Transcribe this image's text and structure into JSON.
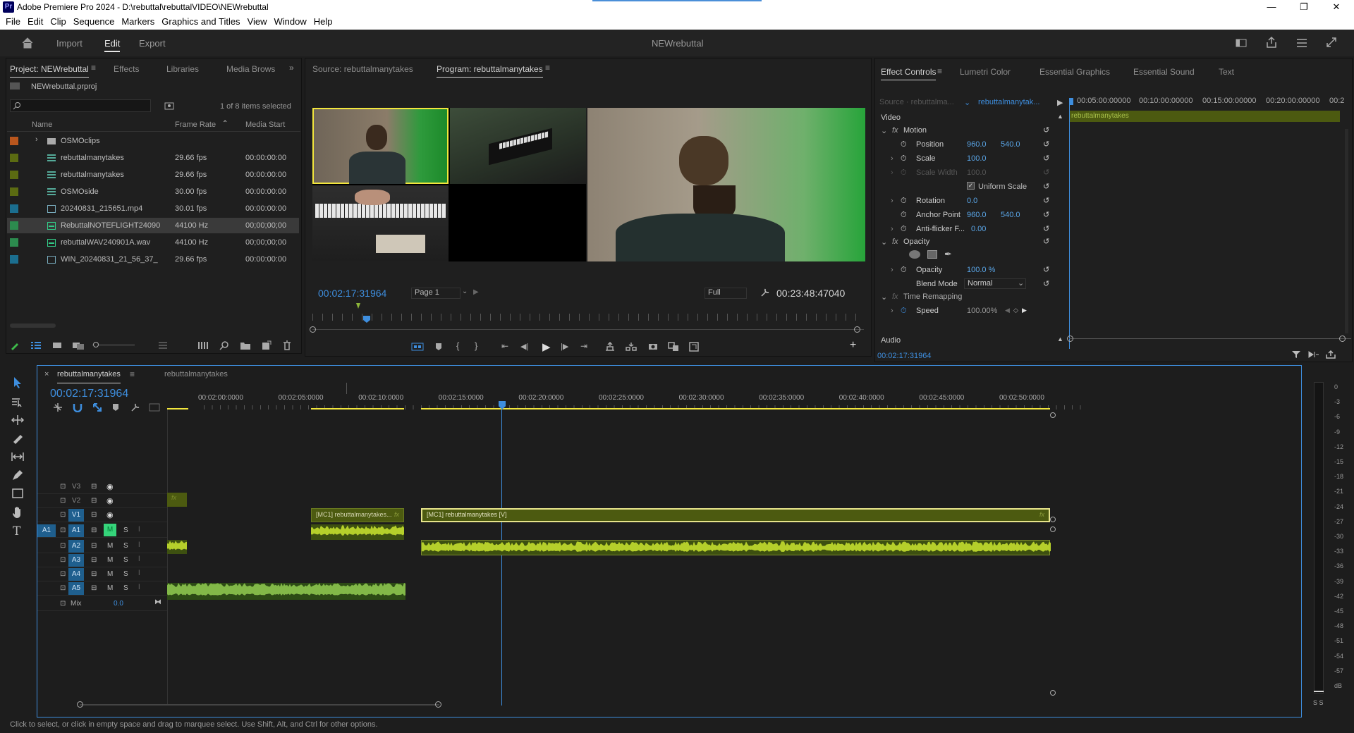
{
  "window": {
    "title": "Adobe Premiere Pro 2024 - D:\\rebuttal\\rebuttalVIDEO\\NEWrebuttal",
    "app_badge": "Pr",
    "minimize": "—",
    "maximize": "❐",
    "close": "✕"
  },
  "menu": [
    "File",
    "Edit",
    "Clip",
    "Sequence",
    "Markers",
    "Graphics and Titles",
    "View",
    "Window",
    "Help"
  ],
  "workspace": {
    "tabs": [
      "Import",
      "Edit",
      "Export"
    ],
    "active": "Edit",
    "project_name": "NEWrebuttal"
  },
  "project_panel": {
    "tabs": [
      "Project: NEWrebuttal",
      "Effects",
      "Libraries",
      "Media Brows"
    ],
    "file": "NEWrebuttal.prproj",
    "selection_count": "1 of 8 items selected",
    "columns": [
      "Name",
      "Frame Rate",
      "Media Start"
    ],
    "items": [
      {
        "name": "OSMOclips",
        "rate": "",
        "start": "",
        "color": "#b9561d",
        "type": "folder"
      },
      {
        "name": "rebuttalmanytakes",
        "rate": "29.66 fps",
        "start": "00:00:00:00",
        "color": "#5b6b12",
        "type": "sequence"
      },
      {
        "name": "rebuttalmanytakes",
        "rate": "29.66 fps",
        "start": "00:00:00:00",
        "color": "#5b6b12",
        "type": "multicam"
      },
      {
        "name": "OSMOside",
        "rate": "30.00 fps",
        "start": "00:00:00:00",
        "color": "#5b6b12",
        "type": "multicam"
      },
      {
        "name": "20240831_215651.mp4",
        "rate": "30.01 fps",
        "start": "00:00:00:00",
        "color": "#1b6e8f",
        "type": "video"
      },
      {
        "name": "RebuttalNOTEFLIGHT24090",
        "rate": "44100 Hz",
        "start": "00;00;00;00",
        "color": "#2c8b4e",
        "type": "audio"
      },
      {
        "name": "rebuttalWAV240901A.wav",
        "rate": "44100 Hz",
        "start": "00;00;00;00",
        "color": "#2c8b4e",
        "type": "audio"
      },
      {
        "name": "WIN_20240831_21_56_37_",
        "rate": "29.66 fps",
        "start": "00:00:00:00",
        "color": "#1b6e8f",
        "type": "video"
      }
    ]
  },
  "monitor": {
    "tabs": [
      "Source: rebuttalmanytakes",
      "Program: rebuttalmanytakes"
    ],
    "timecode": "00:02:17:31964",
    "page": "Page 1",
    "resolution": "Full",
    "duration": "00:23:48:47040"
  },
  "effect_controls": {
    "tabs": [
      "Effect Controls",
      "Lumetri Color",
      "Essential Graphics",
      "Essential Sound",
      "Text"
    ],
    "source": "Source · rebuttalma...",
    "clip": "rebuttalmanytak...",
    "ruler": [
      "00:05:00:00000",
      "00:10:00:00000",
      "00:15:00:00000",
      "00:20:00:00000",
      "00:2"
    ],
    "clip_bar": "rebuttalmanytakes",
    "video": "Video",
    "motion": "Motion",
    "position_label": "Position",
    "position_x": "960.0",
    "position_y": "540.0",
    "scale_label": "Scale",
    "scale": "100.0",
    "scale_width_label": "Scale Width",
    "scale_width": "100.0",
    "uniform_label": "Uniform Scale",
    "rotation_label": "Rotation",
    "rotation": "0.0",
    "anchor_label": "Anchor Point",
    "anchor_x": "960.0",
    "anchor_y": "540.0",
    "antiflicker_label": "Anti-flicker F...",
    "antiflicker": "0.00",
    "opacity_group": "Opacity",
    "opacity_label": "Opacity",
    "opacity": "100.0 %",
    "blend_label": "Blend Mode",
    "blend": "Normal",
    "remap": "Time Remapping",
    "speed_label": "Speed",
    "speed": "100.00%",
    "audio": "Audio",
    "timecode": "00:02:17:31964"
  },
  "timeline": {
    "tabs": [
      "rebuttalmanytakes",
      "rebuttalmanytakes"
    ],
    "timecode": "00:02:17:31964",
    "ruler": [
      "00:02:00:0000",
      "00:02:05:0000",
      "00:02:10:0000",
      "00:02:15:0000",
      "00:02:20:0000",
      "00:02:25:0000",
      "00:02:30:0000",
      "00:02:35:0000",
      "00:02:40:0000",
      "00:02:45:0000",
      "00:02:50:0000"
    ],
    "tracks": {
      "v": [
        "V3",
        "V2",
        "V1"
      ],
      "a": [
        "A1",
        "A2",
        "A3",
        "A4",
        "A5"
      ],
      "src_a": "A1",
      "mix": "Mix",
      "mix_val": "0.0"
    },
    "clip1": "[MC1] rebuttalmanytakes...",
    "clip2": "[MC1] rebuttalmanytakes [V]",
    "fx": "fx"
  },
  "meters": [
    "0",
    "-3",
    "-6",
    "-9",
    "-12",
    "-15",
    "-18",
    "-21",
    "-24",
    "-27",
    "-30",
    "-33",
    "-36",
    "-39",
    "-42",
    "-45",
    "-48",
    "-51",
    "-54",
    "-57",
    "dB"
  ],
  "meter_solo": "S S",
  "status": "Click to select, or click in empty space and drag to marquee select. Use Shift, Alt, and Ctrl for other options.",
  "colors": {
    "accent_blue": "#3e8ede",
    "clip_green": "#4c5a10",
    "wave_green": "#b5cf2b",
    "yellow": "#f2e63d"
  }
}
